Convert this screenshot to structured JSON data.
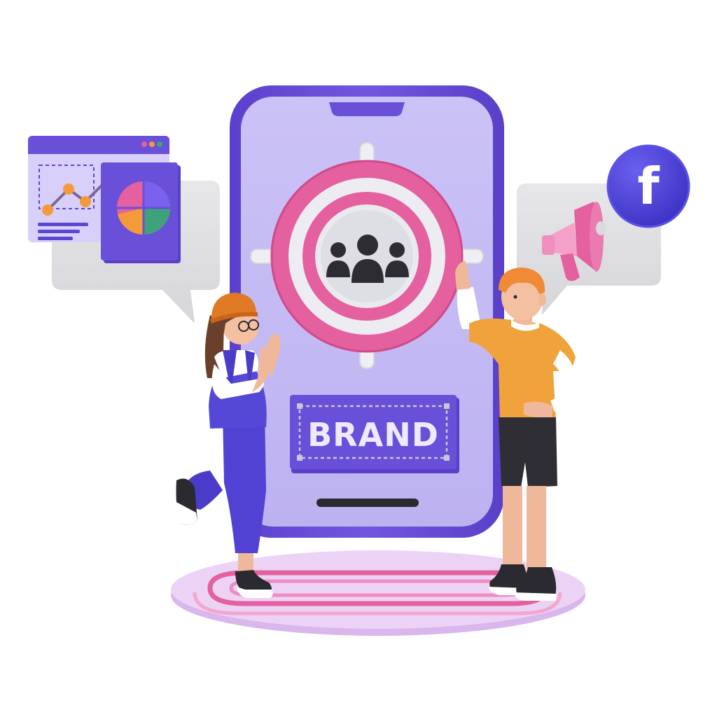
{
  "brand_label": "BRAND",
  "social_badge_letter": "f",
  "colors": {
    "phone_frame": "#6a4fd8",
    "phone_screen": "#c6bdf4",
    "target_pink": "#e4609e",
    "target_gray": "#e9e9ee",
    "brand_plate": "#6a4fd8",
    "facebook_blue": "#4a3fd8",
    "platform": "#e8c8f2",
    "platform_ring": "#e4609e",
    "chart_orange": "#f59a3b",
    "chart_green": "#3ea37a",
    "chart_pink": "#e4609e",
    "chart_purple": "#6a4fd8"
  },
  "icons": [
    "audience-icon",
    "target-crosshair-icon",
    "facebook-icon",
    "megaphone-icon",
    "line-chart-icon",
    "pie-chart-icon"
  ]
}
